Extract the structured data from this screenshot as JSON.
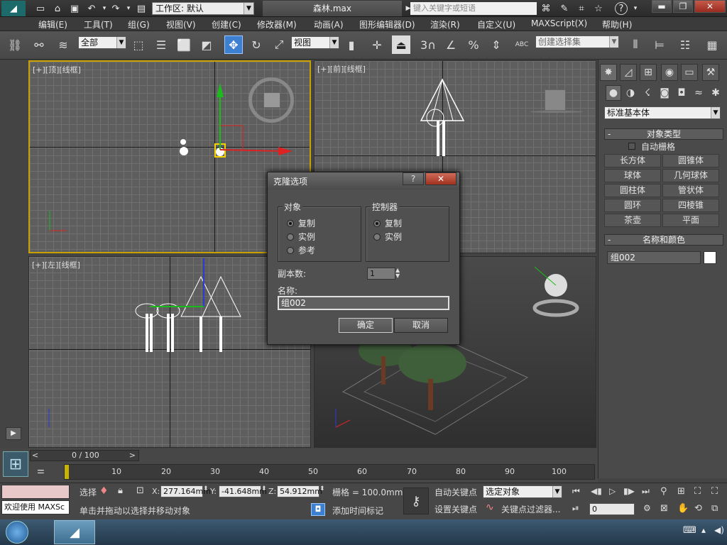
{
  "titlebar": {
    "workspace_label": "工作区: 默认",
    "file_name": "森林.max",
    "search_placeholder": "键入关键字或短语"
  },
  "menu": [
    "编辑(E)",
    "工具(T)",
    "组(G)",
    "视图(V)",
    "创建(C)",
    "修改器(M)",
    "动画(A)",
    "图形编辑器(D)",
    "渲染(R)",
    "自定义(U)",
    "MAXScript(X)",
    "帮助(H)"
  ],
  "toolbar": {
    "filter_value": "全部",
    "coord_system": "视图",
    "named_selection": "创建选择集",
    "snap_3": "3",
    "percent": "%",
    "abc": "ABC"
  },
  "viewports": {
    "top": "[+][顶][线框]",
    "front": "[+][前][线框]",
    "left": "[+][左][线框]"
  },
  "command_panel": {
    "category": "标准基本体",
    "object_type_title": "对象类型",
    "auto_grid": "自动栅格",
    "buttons": [
      "长方体",
      "圆锥体",
      "球体",
      "几何球体",
      "圆柱体",
      "管状体",
      "圆环",
      "四棱锥",
      "茶壶",
      "平面"
    ],
    "name_color_title": "名称和颜色",
    "object_name": "组002",
    "rollout_minus": "-"
  },
  "dialog": {
    "title": "克隆选项",
    "help": "?",
    "object_group": "对象",
    "object_options": [
      "复制",
      "实例",
      "参考"
    ],
    "object_selected": 0,
    "controller_group": "控制器",
    "controller_options": [
      "复制",
      "实例"
    ],
    "controller_selected": 0,
    "copies_label": "副本数:",
    "copies_value": "1",
    "name_label": "名称:",
    "name_value": "组002",
    "ok": "确定",
    "cancel": "取消"
  },
  "timeline": {
    "frame_display": "0 / 100",
    "ticks": [
      "10",
      "20",
      "30",
      "40",
      "50",
      "60",
      "70",
      "80",
      "90",
      "100"
    ]
  },
  "status": {
    "welcome": "欢迎使用 MAXSc",
    "select_label": "选择",
    "x_label": "X:",
    "x_value": "277.164mm",
    "y_label": "Y:",
    "y_value": "-41.648mm",
    "z_label": "Z:",
    "z_value": "54.912mm",
    "grid": "栅格 = 100.0mm",
    "auto_key": "自动关键点",
    "set_key": "设置关键点",
    "key_mode": "选定对象",
    "key_filters": "关键点过滤器...",
    "prompt": "单击并拖动以选择并移动对象",
    "add_time_tag": "添加时间标记",
    "frame_value": "0"
  }
}
